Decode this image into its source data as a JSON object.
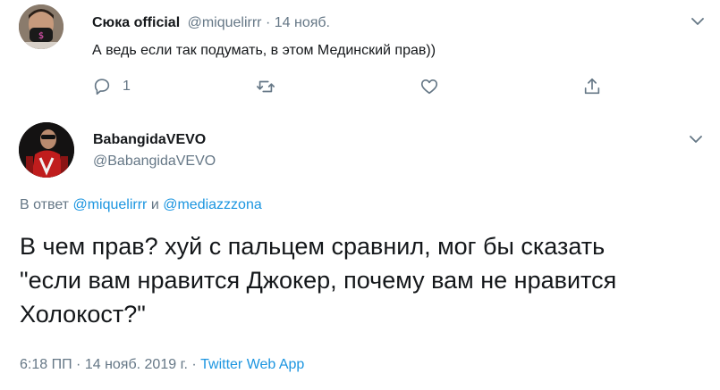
{
  "reply_tweet": {
    "author_name": "Сюка official",
    "author_handle": "@miquelirrr",
    "separator": "·",
    "time": "14 нояб.",
    "text": "А ведь если так подумать, в этом Мединский прав))",
    "reply_count": "1",
    "avatar_mask_text": "$"
  },
  "main_tweet": {
    "author_name": "BabangidaVEVO",
    "author_handle": "@BabangidaVEVO",
    "reply_prefix": "В ответ",
    "reply_user_1": "@miquelirrr",
    "reply_and": "и",
    "reply_user_2": "@mediazzzona",
    "text_line_1": "В чем прав? хуй с пальцем сравнил, мог бы сказать",
    "text_line_2": "\"если вам нравится Джокер, почему вам не нравится",
    "text_line_3": "Холокост?\"",
    "meta_time": "6:18 ПП",
    "meta_dot_1": "·",
    "meta_date": "14 нояб. 2019 г.",
    "meta_dot_2": "·",
    "meta_source": "Twitter Web App"
  },
  "colors": {
    "link": "#1b95e0",
    "muted": "#657786",
    "text": "#14171a",
    "connector": "#ccd6dd"
  },
  "icons": [
    "reply-icon",
    "retweet-icon",
    "like-icon",
    "share-icon",
    "chevron-down-icon"
  ]
}
